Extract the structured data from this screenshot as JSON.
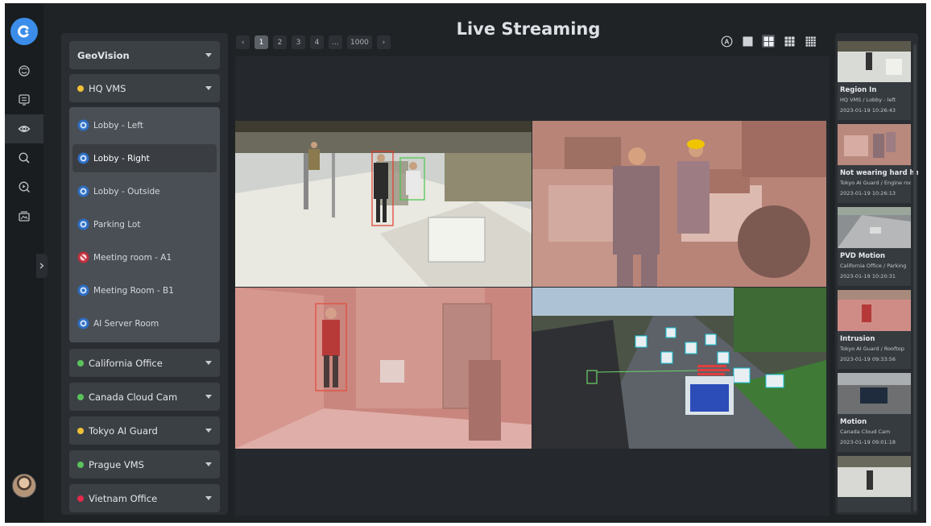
{
  "app": {
    "title": "Live Streaming"
  },
  "colors": {
    "accent": "#3b8de9",
    "status_yellow": "#f0c036",
    "status_green": "#5bc25b",
    "status_red": "#e2294a"
  },
  "rail": {
    "icons": [
      "smile-face-icon",
      "monitor-list-icon",
      "eye-icon",
      "search-icon",
      "play-search-icon",
      "gallery-icon"
    ],
    "active": "eye-icon"
  },
  "tree": {
    "root": {
      "label": "GeoVision"
    },
    "groups": [
      {
        "label": "HQ VMS",
        "status": "yellow",
        "expanded": true
      },
      {
        "label": "California Office",
        "status": "green"
      },
      {
        "label": "Canada Cloud Cam",
        "status": "green"
      },
      {
        "label": "Tokyo AI Guard",
        "status": "yellow"
      },
      {
        "label": "Prague VMS",
        "status": "green"
      },
      {
        "label": "Vietnam Office",
        "status": "red"
      }
    ],
    "cameras": [
      {
        "label": "Lobby - Left",
        "status": "ok"
      },
      {
        "label": "Lobby - Right",
        "status": "ok",
        "selected": true
      },
      {
        "label": "Lobby - Outside",
        "status": "ok"
      },
      {
        "label": "Parking Lot",
        "status": "ok"
      },
      {
        "label": "Meeting room - A1",
        "status": "error"
      },
      {
        "label": "Meeting Room - B1",
        "status": "ok"
      },
      {
        "label": "AI Server Room",
        "status": "ok"
      }
    ]
  },
  "pager": {
    "prev": "‹",
    "pages": [
      "1",
      "2",
      "3",
      "4",
      "...",
      "1000"
    ],
    "active": "1",
    "next": "›"
  },
  "layouts": {
    "auto_label": "A",
    "active": "2x2"
  },
  "events": [
    {
      "title": "Region In",
      "source": "HQ VMS / Lobby - left",
      "time": "2023-01-19 10:26:43"
    },
    {
      "title": "Not wearing hard hats",
      "source": "Tokyo AI Guard / Engine room",
      "time": "2023-01-19 10:26:13"
    },
    {
      "title": "PVD Motion",
      "source": "California Office / Parking",
      "time": "2023-01-19 10:20:31"
    },
    {
      "title": "Intrusion",
      "source": "Tokyo AI Guard / Rooftop",
      "time": "2023-01-19 09:33:56"
    },
    {
      "title": "Motion",
      "source": "Canada Cloud Cam",
      "time": "2023-01-19 09:01:18"
    }
  ]
}
